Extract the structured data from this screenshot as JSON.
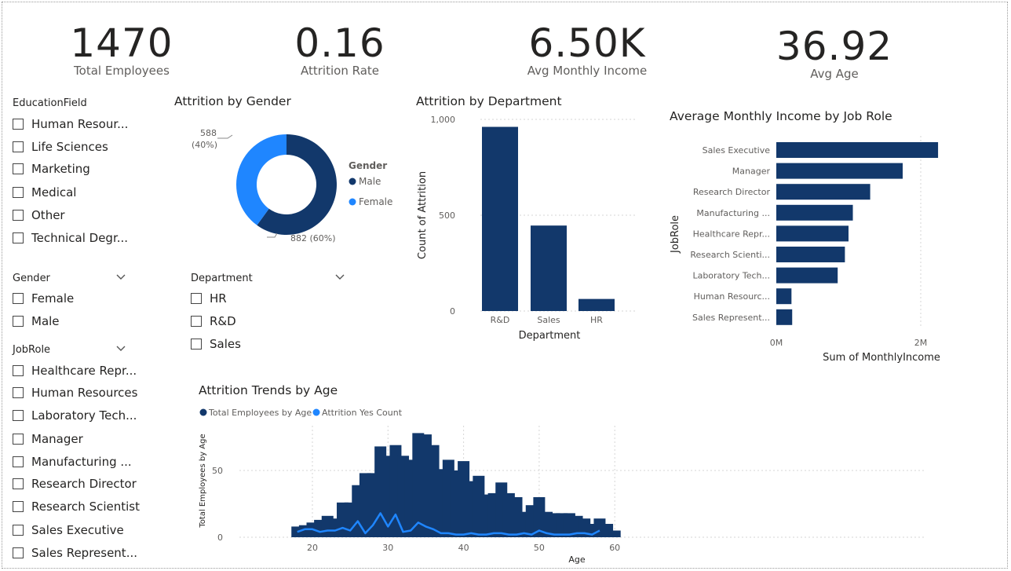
{
  "kpis": [
    {
      "value": "1470",
      "label": "Total Employees"
    },
    {
      "value": "0.16",
      "label": "Attrition Rate"
    },
    {
      "value": "6.50K",
      "label": "Avg Monthly Income"
    },
    {
      "value": "36.92",
      "label": "Avg Age"
    }
  ],
  "slicers": {
    "education": {
      "title": "EducationField",
      "items": [
        "Human Resour...",
        "Life Sciences",
        "Marketing",
        "Medical",
        "Other",
        "Technical Degr..."
      ]
    },
    "gender": {
      "title": "Gender",
      "items": [
        "Female",
        "Male"
      ]
    },
    "jobrole": {
      "title": "JobRole",
      "items": [
        "Healthcare Repr...",
        "Human Resources",
        "Laboratory Tech...",
        "Manager",
        "Manufacturing ...",
        "Research Director",
        "Research Scientist",
        "Sales Executive",
        "Sales Represent..."
      ]
    },
    "department": {
      "title": "Department",
      "items": [
        "HR",
        "R&D",
        "Sales"
      ]
    }
  },
  "colors": {
    "dark": "#12386b",
    "light": "#1f86ff",
    "grid": "#d6d6d6",
    "axis": "#605e5c"
  },
  "chart_data": [
    {
      "type": "pie",
      "title": "Attrition by Gender",
      "legend_title": "Gender",
      "legend_position": "right",
      "slices": [
        {
          "name": "Male",
          "value": 882,
          "pct": "60%",
          "label": "882 (60%)"
        },
        {
          "name": "Female",
          "value": 588,
          "pct": "40%",
          "label": "588\n(40%)"
        }
      ]
    },
    {
      "type": "bar",
      "title": "Attrition by Department",
      "categories": [
        "R&D",
        "Sales",
        "HR"
      ],
      "values": [
        961,
        446,
        63
      ],
      "xlabel": "Department",
      "ylabel": "Count of Attrition",
      "ylim": [
        0,
        1000
      ],
      "yticks": [
        "0",
        "500",
        "1,000"
      ],
      "grid": true
    },
    {
      "type": "bar",
      "orientation": "horizontal",
      "title": "Average Monthly Income by Job Role",
      "categories": [
        "Sales Executive",
        "Manager",
        "Research Director",
        "Manufacturing ...",
        "Healthcare Repr...",
        "Research Scienti...",
        "Laboratory Tech...",
        "Human Resourc...",
        "Sales Represent..."
      ],
      "values": [
        2240000,
        1750000,
        1300000,
        1060000,
        1000000,
        950000,
        850000,
        210000,
        220000
      ],
      "xlabel": "Sum of MonthlyIncome",
      "ylabel": "JobRole",
      "xlim": [
        0,
        2400000
      ],
      "xticks": [
        "0M",
        "2M"
      ]
    },
    {
      "type": "bar",
      "title": "Attrition Trends by Age",
      "x": [
        18,
        19,
        20,
        21,
        22,
        23,
        24,
        25,
        26,
        27,
        28,
        29,
        30,
        31,
        32,
        33,
        34,
        35,
        36,
        37,
        38,
        39,
        40,
        41,
        42,
        43,
        44,
        45,
        46,
        47,
        48,
        49,
        50,
        51,
        52,
        53,
        54,
        55,
        56,
        57,
        58,
        59,
        60
      ],
      "series": [
        {
          "name": "Total Employees by Age",
          "type": "bar",
          "values": [
            8,
            9,
            11,
            13,
            16,
            14,
            26,
            26,
            39,
            48,
            48,
            68,
            61,
            69,
            61,
            58,
            78,
            77,
            69,
            51,
            58,
            50,
            57,
            42,
            46,
            32,
            33,
            41,
            33,
            30,
            19,
            24,
            30,
            19,
            18,
            18,
            18,
            16,
            14,
            10,
            14,
            10,
            5
          ]
        },
        {
          "name": "Attrition Yes Count",
          "type": "line",
          "values": [
            4,
            6,
            6,
            4,
            5,
            5,
            7,
            5,
            12,
            3,
            9,
            18,
            8,
            17,
            4,
            5,
            11,
            8,
            6,
            3,
            3,
            2,
            2,
            3,
            2,
            2,
            3,
            3,
            2,
            2,
            3,
            2,
            5,
            3,
            2,
            2,
            2,
            3,
            3,
            2,
            5,
            null,
            null
          ]
        }
      ],
      "xlabel": "Age",
      "ylabel": "Total Employees by Age",
      "ylim": [
        0,
        80
      ],
      "yticks": [
        "0",
        "50"
      ],
      "xticks": [
        "20",
        "30",
        "40",
        "50",
        "60"
      ],
      "legend_position": "top-left",
      "grid": true
    }
  ]
}
